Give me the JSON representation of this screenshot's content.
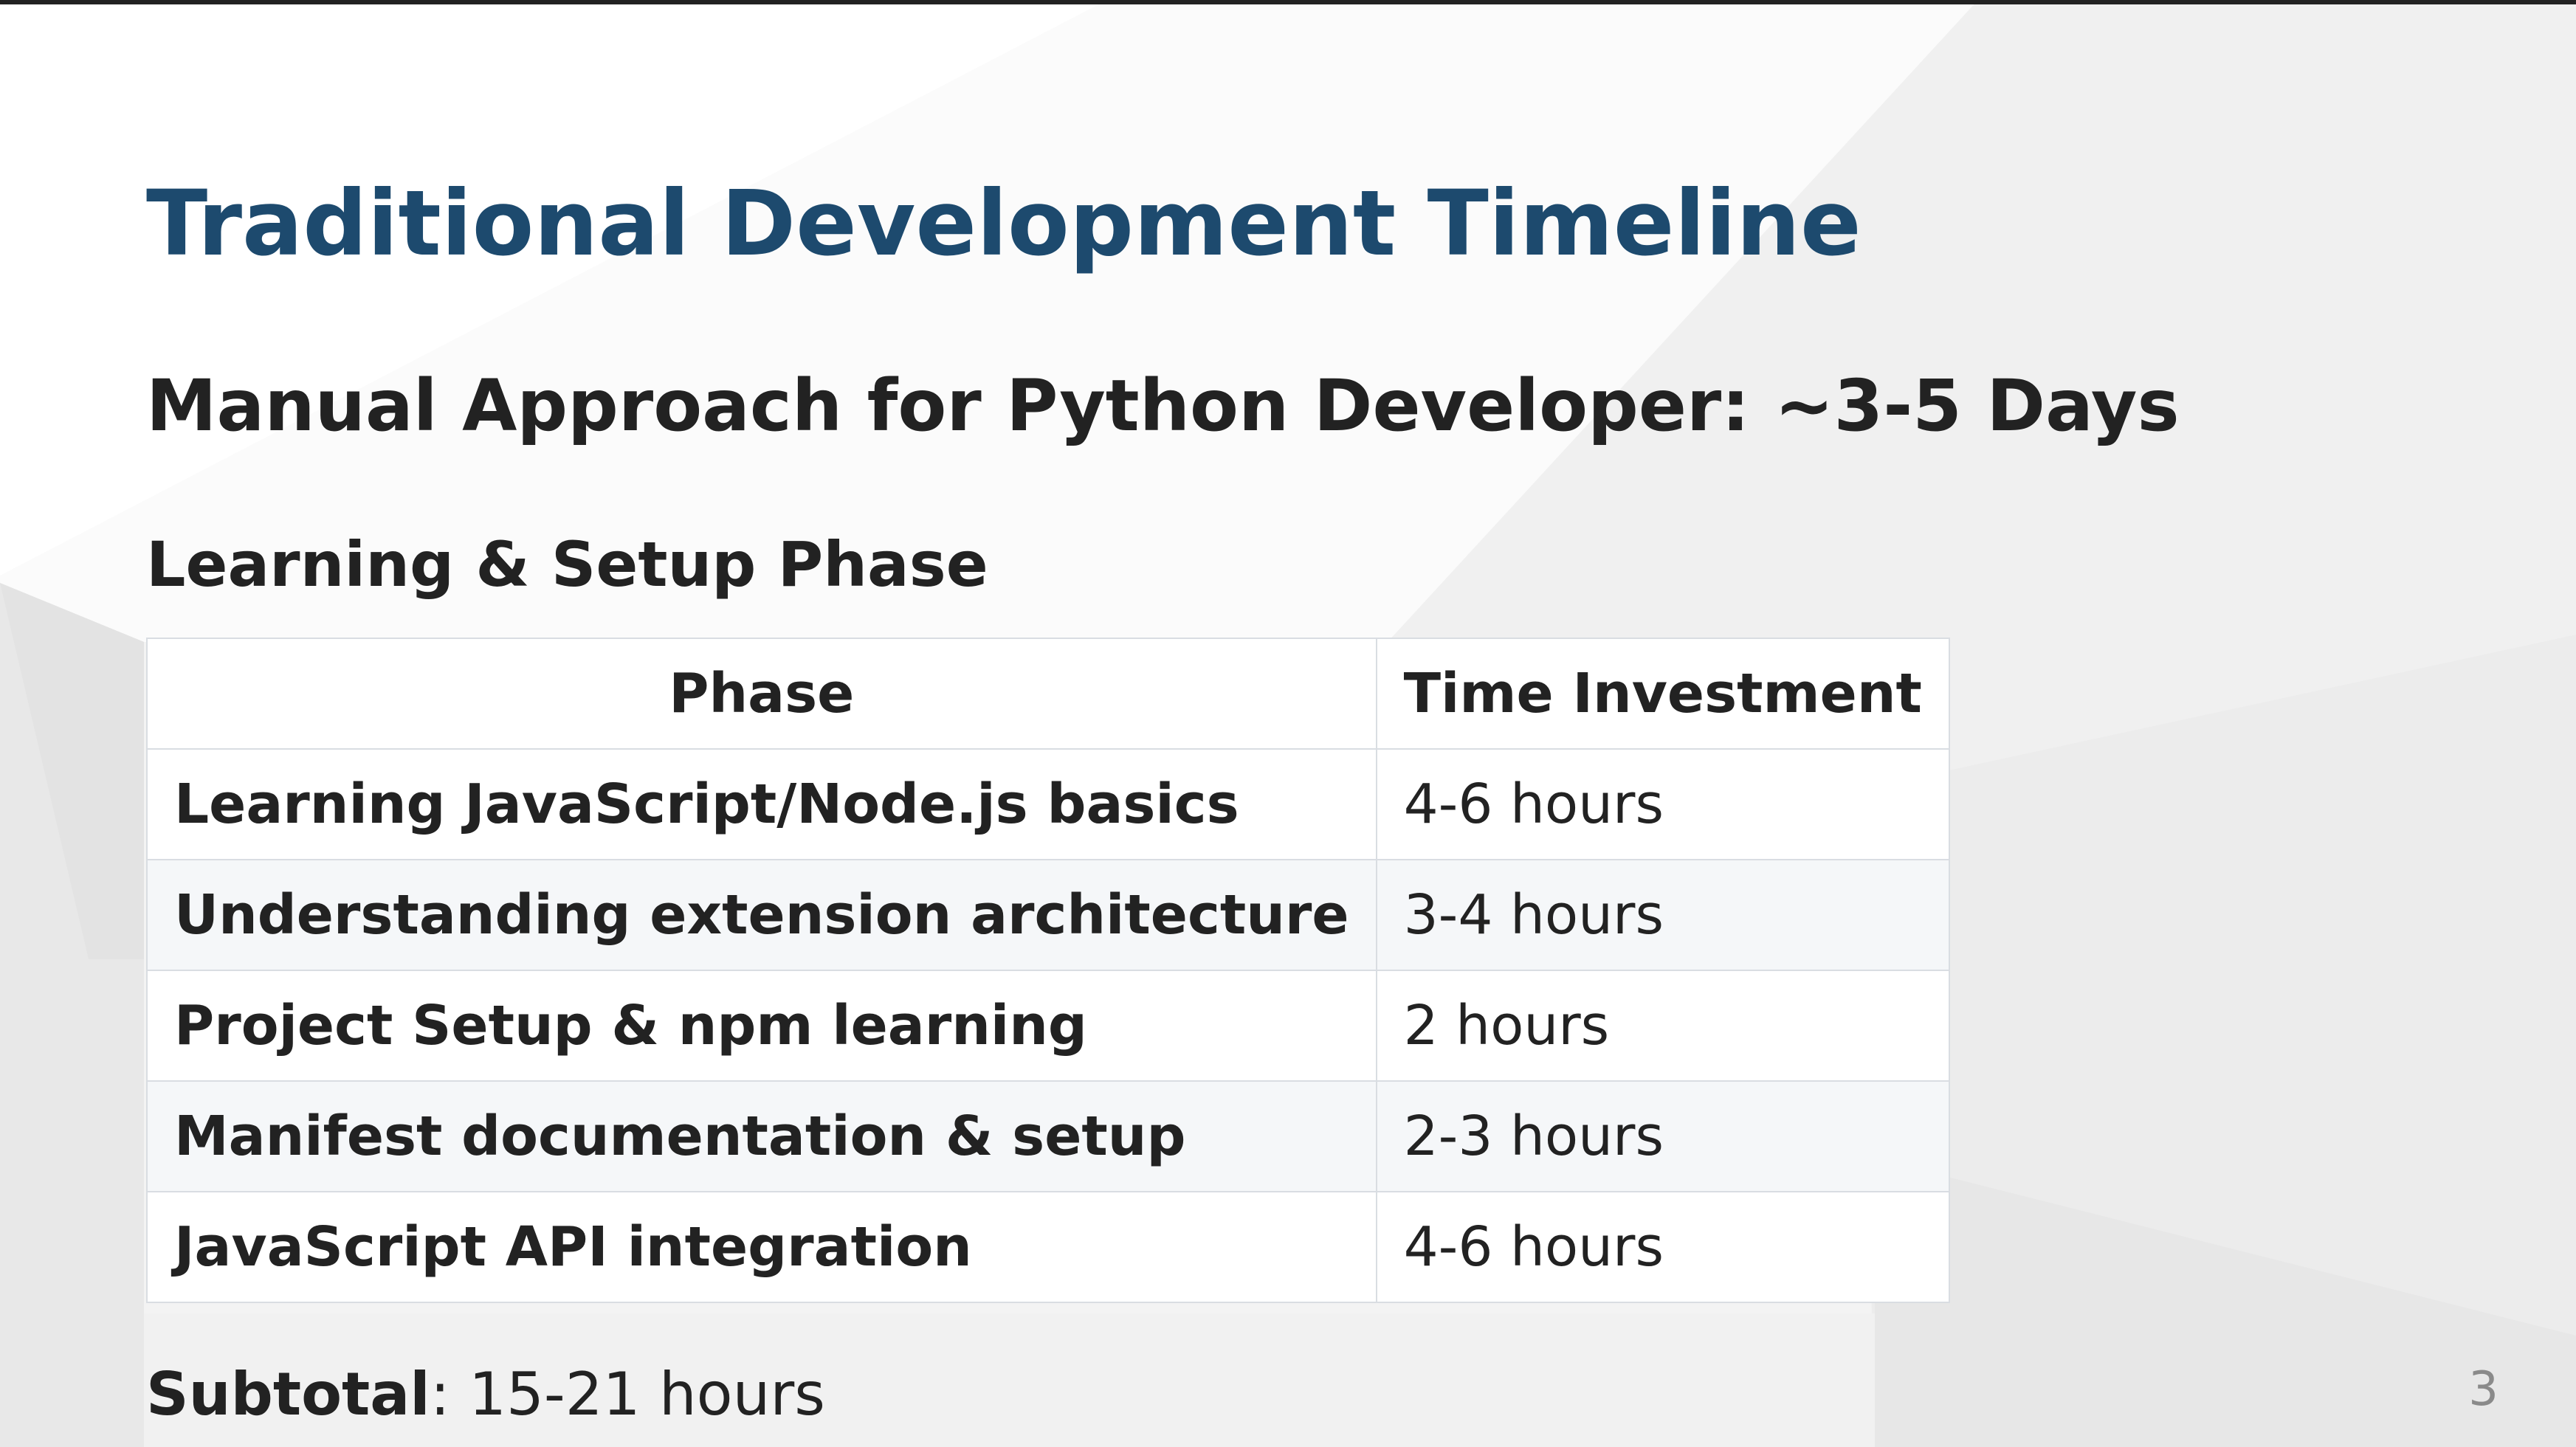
{
  "slide": {
    "title": "Traditional Development Timeline",
    "subtitle": "Manual Approach for Python Developer: ~3-5 Days",
    "section_heading": "Learning & Setup Phase",
    "table": {
      "headers": [
        "Phase",
        "Time Investment"
      ],
      "rows": [
        {
          "phase": "Learning JavaScript/Node.js basics",
          "time": "4-6 hours"
        },
        {
          "phase": "Understanding extension architecture",
          "time": "3-4 hours"
        },
        {
          "phase": "Project Setup & npm learning",
          "time": "2 hours"
        },
        {
          "phase": "Manifest documentation & setup",
          "time": "2-3 hours"
        },
        {
          "phase": "JavaScript API integration",
          "time": "4-6 hours"
        }
      ]
    },
    "subtotal": {
      "label": "Subtotal",
      "separator": ": ",
      "value": "15-21 hours"
    },
    "page_number": "3"
  },
  "colors": {
    "title": "#1d4a6e",
    "text": "#222222",
    "table_border": "#d9dde2",
    "row_stripe": "#f5f7f9",
    "page_number": "#8a8a8a"
  }
}
